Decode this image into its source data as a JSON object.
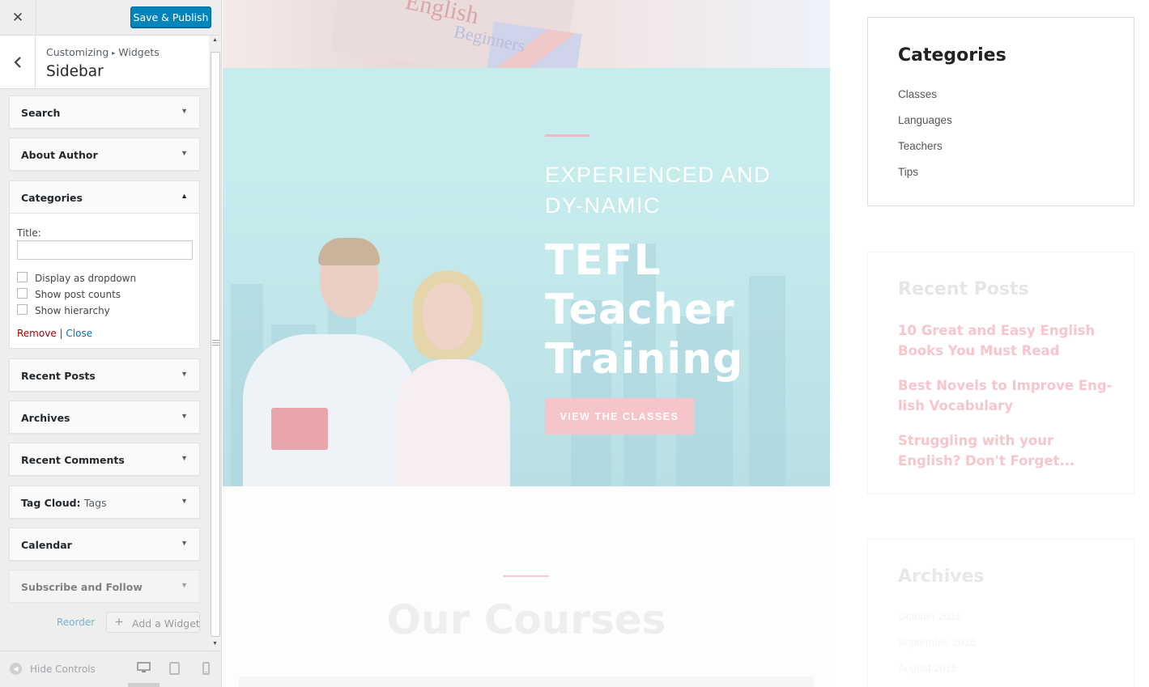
{
  "customizer": {
    "close_label": "✕",
    "publish_label": "Save & Publish",
    "breadcrumb": {
      "root": "Customizing",
      "separator": "▸",
      "current": "Widgets"
    },
    "section_title": "Sidebar",
    "widgets_top": [
      {
        "title": "Search",
        "sub": ""
      },
      {
        "title": "About Author",
        "sub": ""
      }
    ],
    "categories_widget": {
      "title": "Categories",
      "title_field_label": "Title:",
      "title_field_value": "",
      "options": [
        "Display as dropdown",
        "Show post counts",
        "Show hierarchy"
      ],
      "remove_label": "Remove",
      "link_separator": "|",
      "close_label": "Close"
    },
    "widgets_bottom": [
      {
        "title": "Recent Posts",
        "sub": ""
      },
      {
        "title": "Archives",
        "sub": ""
      },
      {
        "title": "Recent Comments",
        "sub": ""
      },
      {
        "title": "Tag Cloud:",
        "sub": "Tags"
      },
      {
        "title": "Calendar",
        "sub": ""
      },
      {
        "title": "Subscribe and Follow",
        "sub": ""
      }
    ],
    "reorder_label": "Reorder",
    "add_widget_label": "Add a Widget",
    "hide_controls_label": "Hide Controls",
    "devices": [
      "desktop-icon",
      "tablet-icon",
      "mobile-icon"
    ],
    "accent_color": "#0085ba"
  },
  "preview": {
    "book_text": [
      "English",
      "Beginners"
    ],
    "hero": {
      "subtitle": "EXPERIENCED AND DY-NAMIC",
      "title": "TEFL Teacher Training",
      "button": "VIEW THE CLASSES",
      "accent_color": "#f6c5ca"
    },
    "courses_title": "Our Courses",
    "sidebar": {
      "categories_title": "Categories",
      "categories": [
        "Classes",
        "Languages",
        "Teachers",
        "Tips"
      ],
      "recent_posts_title": "Recent Posts",
      "recent_posts": [
        "10 Great and Easy English Books You Must Read",
        "Best Novels to Improve Eng-lish Vocabulary",
        "Struggling with your English? Don't Forget..."
      ],
      "archives_title": "Archives",
      "archives": [
        "October 2016",
        "September 2016",
        "August 2016"
      ]
    }
  }
}
